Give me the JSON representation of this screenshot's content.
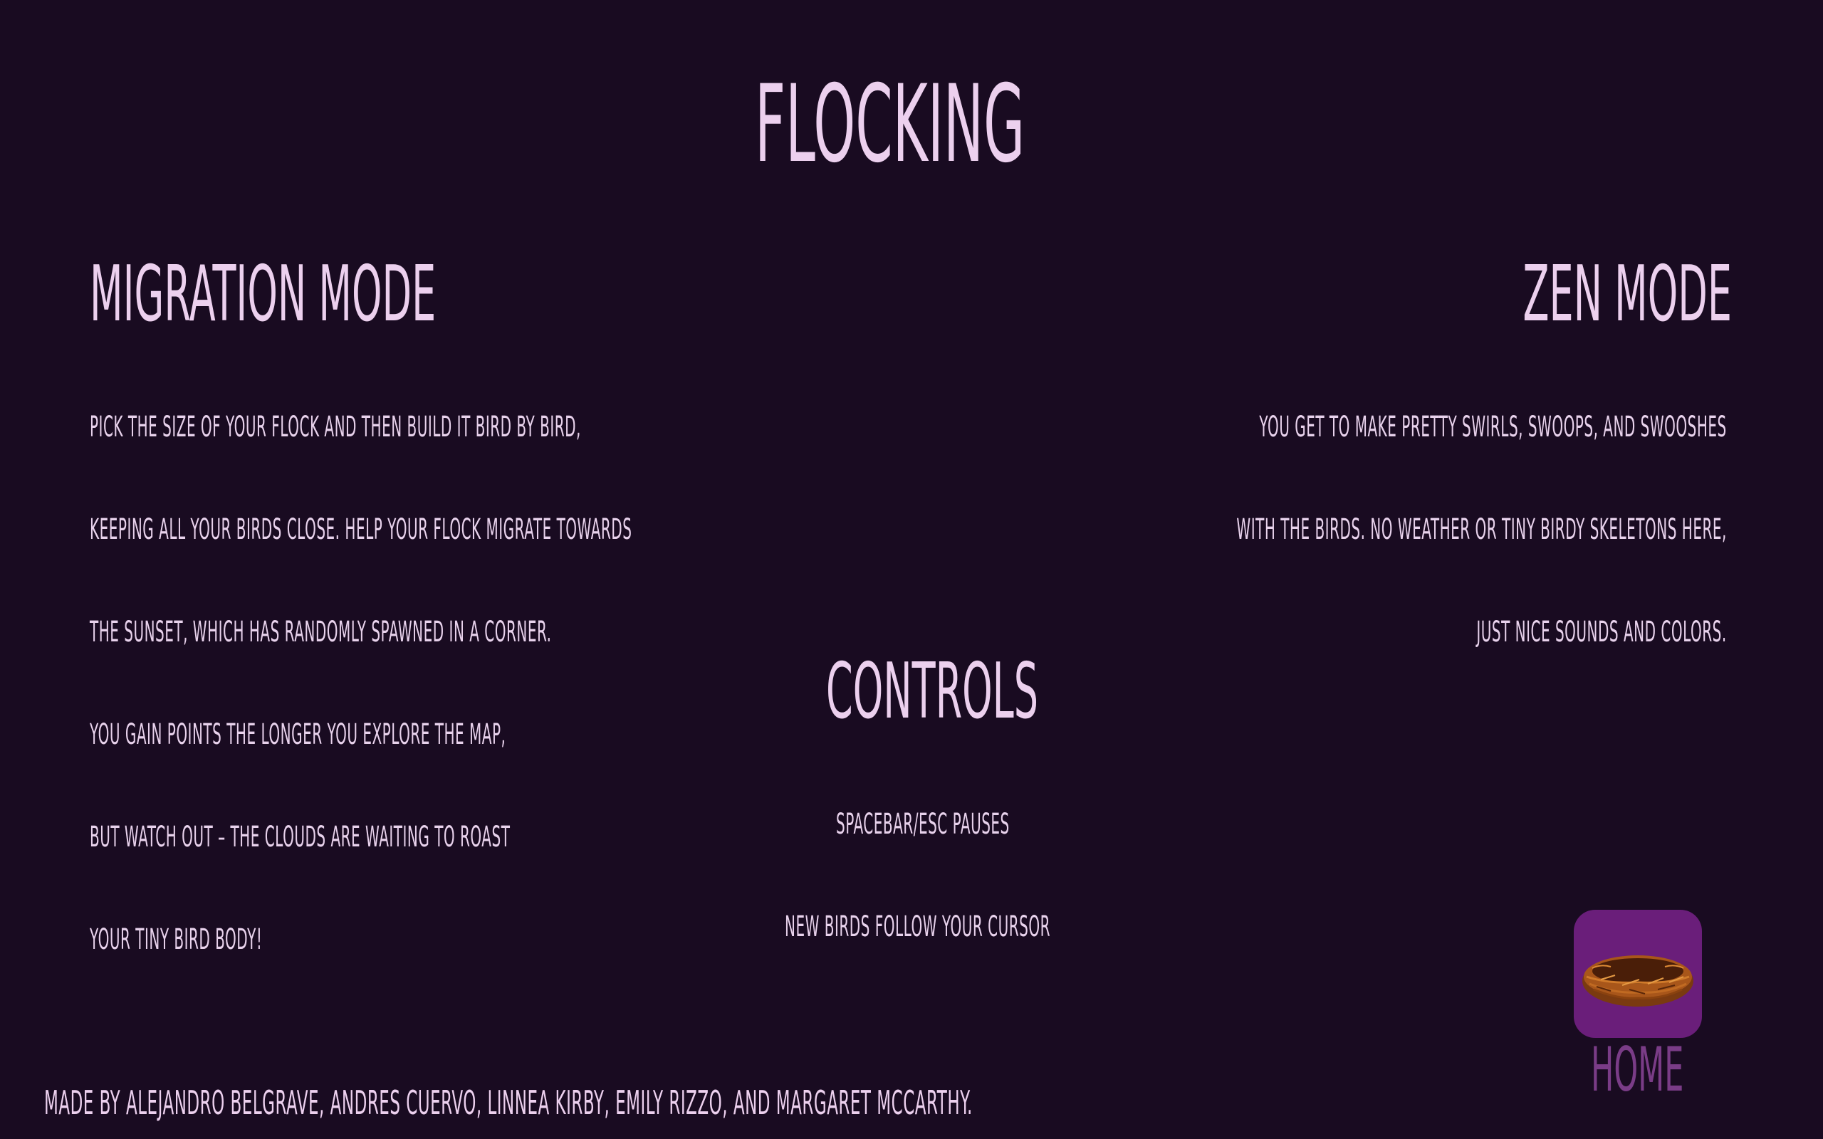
{
  "title": "FLOCKING",
  "migration": {
    "heading": "MIGRATION MODE",
    "lines": [
      "PICK THE SIZE OF YOUR FLOCK AND THEN BUILD IT BIRD BY BIRD,",
      "KEEPING ALL YOUR BIRDS CLOSE. HELP YOUR FLOCK MIGRATE TOWARDS",
      "THE SUNSET, WHICH HAS RANDOMLY SPAWNED IN A CORNER.",
      "YOU GAIN POINTS THE LONGER YOU EXPLORE THE MAP,",
      "BUT WATCH OUT – THE CLOUDS ARE WAITING TO ROAST",
      "YOUR TINY BIRD BODY!"
    ]
  },
  "zen": {
    "heading": "ZEN MODE",
    "lines": [
      "YOU GET TO MAKE PRETTY SWIRLS, SWOOPS, AND SWOOSHES",
      "WITH THE BIRDS. NO WEATHER OR TINY BIRDY SKELETONS HERE,",
      "JUST NICE SOUNDS AND COLORS."
    ]
  },
  "controls": {
    "heading": "CONTROLS",
    "lines": [
      "SPACEBAR/ESC PAUSES",
      "NEW BIRDS FOLLOW YOUR CURSOR"
    ]
  },
  "credits": "MADE BY ALEJANDRO BELGRAVE, ANDRES CUERVO, LINNEA KIRBY, EMILY RIZZO, AND MARGARET MCCARTHY.",
  "home": {
    "label": "HOME",
    "icon": "nest-icon"
  },
  "colors": {
    "background": "#190b21",
    "text": "#ecd0ee",
    "home_button": "#6a1e7a",
    "home_label": "#7a3c87"
  }
}
